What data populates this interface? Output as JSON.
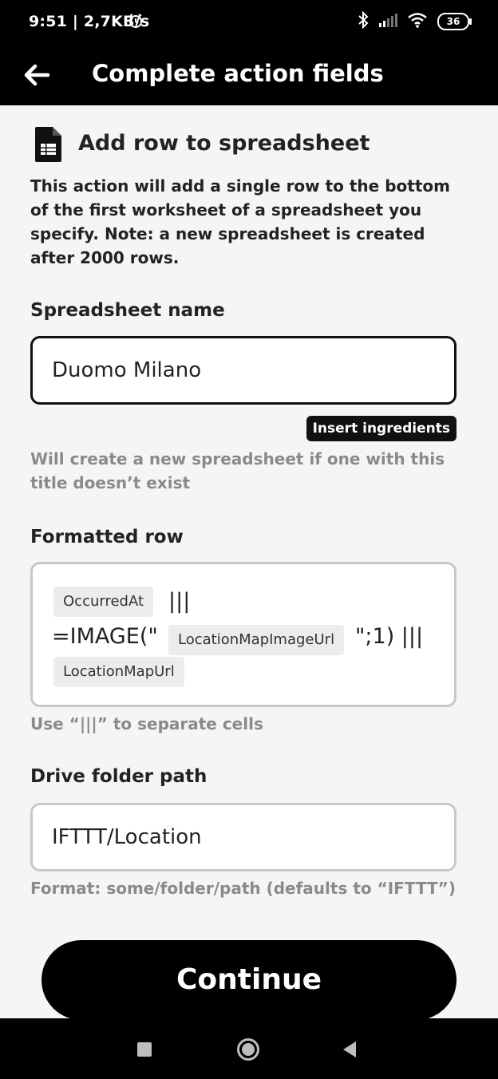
{
  "status": {
    "time": "9:51 | 2,7KB/s",
    "battery": "36"
  },
  "appbar": {
    "title": "Complete action fields"
  },
  "action": {
    "title": "Add row to spreadsheet",
    "description": "This action will add a single row to the bottom of the first worksheet of a spreadsheet you specify. Note: a new spreadsheet is created after 2000 rows."
  },
  "spreadsheet_name": {
    "label": "Spreadsheet name",
    "value": "Duomo Milano",
    "insert_button": "Insert ingredients",
    "hint": "Will create a new spreadsheet if one with this title doesn’t exist"
  },
  "formatted_row": {
    "label": "Formatted row",
    "ingredient_1": "OccurredAt",
    "sep_1": "|||",
    "text_image_open": "=IMAGE(\"",
    "ingredient_2": "LocationMapImageUrl",
    "text_image_close": "\";1) |||",
    "ingredient_3": "LocationMapUrl",
    "hint": "Use “|||” to separate cells"
  },
  "drive_folder": {
    "label": "Drive folder path",
    "value": "IFTTT/Location",
    "hint": "Format: some/folder/path (defaults to “IFTTT”)"
  },
  "continue_label": "Continue"
}
